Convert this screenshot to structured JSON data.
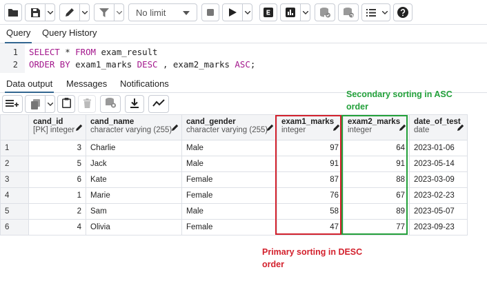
{
  "toolbar": {
    "limit_value": "No limit",
    "icons": [
      "folder-icon",
      "save-icon",
      "edit-icon",
      "filter-icon",
      "stop-icon",
      "execute-icon",
      "explain-icon",
      "explain-analyze-icon",
      "commit-icon",
      "rollback-icon",
      "macros-icon",
      "help-icon"
    ]
  },
  "editor_tabs": [
    "Query",
    "Query History"
  ],
  "editor": {
    "lines": [
      {
        "num": "1",
        "kw1": "SELECT",
        "t1": " * ",
        "kw2": "FROM",
        "t2": " exam_result",
        "kw3": "",
        "t3": ""
      },
      {
        "num": "2",
        "kw1": "ORDER BY",
        "t1": " exam1_marks ",
        "kw2": "DESC",
        "t2": " , exam2_marks ",
        "kw3": "ASC",
        "t3": ";"
      }
    ]
  },
  "output_tabs": [
    "Data output",
    "Messages",
    "Notifications"
  ],
  "columns": [
    {
      "name": "cand_id",
      "type": "[PK] integer"
    },
    {
      "name": "cand_name",
      "type": "character varying (255)"
    },
    {
      "name": "cand_gender",
      "type": "character varying (255)"
    },
    {
      "name": "exam1_marks",
      "type": "integer"
    },
    {
      "name": "exam2_marks",
      "type": "integer"
    },
    {
      "name": "date_of_test",
      "type": "date"
    }
  ],
  "rows": [
    {
      "rn": "1",
      "cand_id": "3",
      "cand_name": "Charlie",
      "cand_gender": "Male",
      "exam1_marks": "97",
      "exam2_marks": "64",
      "date_of_test": "2023-01-06"
    },
    {
      "rn": "2",
      "cand_id": "5",
      "cand_name": "Jack",
      "cand_gender": "Male",
      "exam1_marks": "91",
      "exam2_marks": "91",
      "date_of_test": "2023-05-14"
    },
    {
      "rn": "3",
      "cand_id": "6",
      "cand_name": "Kate",
      "cand_gender": "Female",
      "exam1_marks": "87",
      "exam2_marks": "88",
      "date_of_test": "2023-03-09"
    },
    {
      "rn": "4",
      "cand_id": "1",
      "cand_name": "Marie",
      "cand_gender": "Female",
      "exam1_marks": "76",
      "exam2_marks": "67",
      "date_of_test": "2023-02-23"
    },
    {
      "rn": "5",
      "cand_id": "2",
      "cand_name": "Sam",
      "cand_gender": "Male",
      "exam1_marks": "58",
      "exam2_marks": "89",
      "date_of_test": "2023-05-07"
    },
    {
      "rn": "6",
      "cand_id": "4",
      "cand_name": "Olivia",
      "cand_gender": "Female",
      "exam1_marks": "47",
      "exam2_marks": "77",
      "date_of_test": "2023-09-23"
    }
  ],
  "annotations": {
    "secondary_line1": "Secondary sorting in ASC",
    "secondary_line2": "order",
    "primary_line1": "Primary sorting in DESC",
    "primary_line2": "order"
  },
  "colors": {
    "primary_annotation": "#d3212d",
    "secondary_annotation": "#22a03a",
    "keyword": "#a3168c",
    "active_tab_underline": "#326690"
  }
}
